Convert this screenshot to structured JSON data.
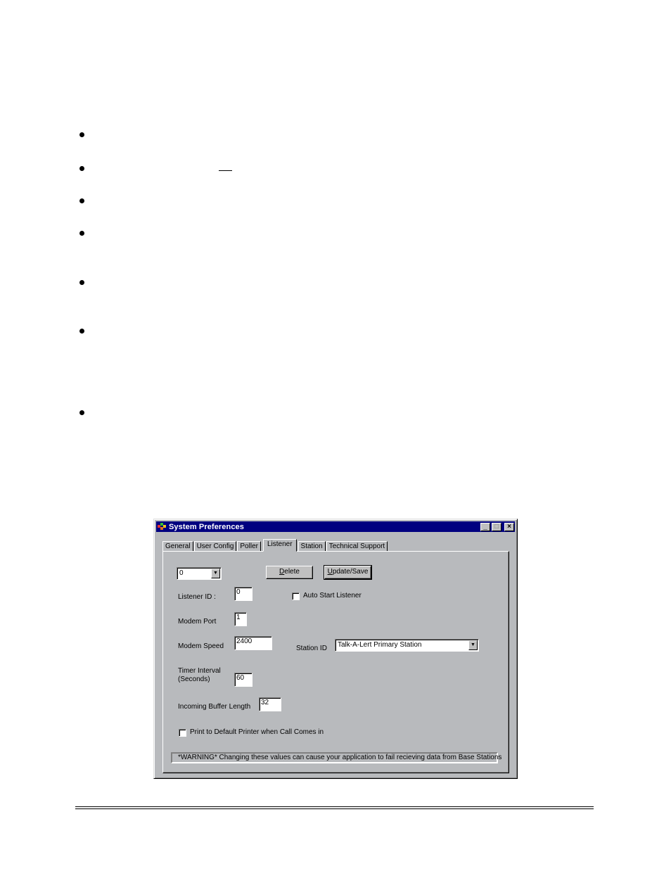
{
  "document": {
    "bullet_count": 7,
    "footer_rule": "double"
  },
  "dialog": {
    "title": "System Preferences",
    "app_icon": "talk-a-lert-app-icon",
    "window_controls": {
      "minimize": "_",
      "maximize": "□",
      "close": "×"
    },
    "tabs": [
      {
        "label": "General",
        "active": false
      },
      {
        "label": "User Config",
        "active": false
      },
      {
        "label": "Poller",
        "active": false
      },
      {
        "label": "Listener",
        "active": true
      },
      {
        "label": "Station",
        "active": false
      },
      {
        "label": "Technical Support",
        "active": false
      }
    ],
    "listener_select": {
      "value": "0"
    },
    "buttons": {
      "delete": {
        "label": "Delete",
        "mnemonic": "D",
        "rest": "elete"
      },
      "update_save": {
        "label": "Update/Save",
        "mnemonic": "U",
        "rest": "pdate/Save"
      }
    },
    "fields": {
      "listener_id": {
        "label": "Listener ID :",
        "value": "0"
      },
      "modem_port": {
        "label": "Modem Port",
        "value": "1"
      },
      "modem_speed": {
        "label": "Modem Speed",
        "value": "2400"
      },
      "timer_interval": {
        "label_line1": "Timer Interval",
        "label_line2": "(Seconds)",
        "value": "60"
      },
      "incoming_buffer_length": {
        "label": "Incoming Buffer Length",
        "value": "32"
      }
    },
    "auto_start_listener": {
      "label": "Auto Start Listener",
      "checked": false
    },
    "station_id": {
      "label": "Station ID",
      "value": "Talk-A-Lert Primary Station"
    },
    "print_on_call": {
      "label": "Print to Default Printer when Call Comes in",
      "checked": false
    },
    "warning": "*WARNING*  Changing these values can cause your application to fail recieving data from Base Stations"
  }
}
